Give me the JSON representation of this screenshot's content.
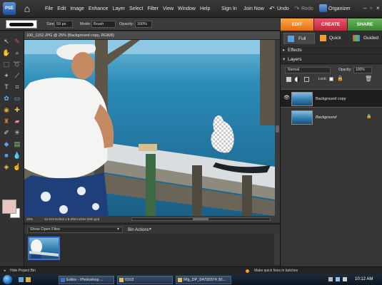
{
  "menubar": {
    "logo": "PSE",
    "items": [
      "File",
      "Edit",
      "Image",
      "Enhance",
      "Layer",
      "Select",
      "Filter",
      "View",
      "Window",
      "Help"
    ],
    "sign_in": "Sign In",
    "join_now": "Join Now",
    "undo": "Undo",
    "redo": "Redo",
    "organizer": "Organizer"
  },
  "options_bar": {
    "size_label": "Size:",
    "size_value": "59 px",
    "mode_label": "Mode:",
    "mode_value": "Brush",
    "opacity_label": "Opacity:",
    "opacity_value": "100%"
  },
  "mode_tabs": {
    "edit": "EDIT",
    "create": "CREATE",
    "share": "SHARE",
    "colors": {
      "edit": "#ef7d1a",
      "create": "#d9334a",
      "share": "#4b9a3c"
    }
  },
  "document": {
    "title": "100_1152.JPG @ 25% (Background copy, RGB/8)",
    "zoom": "25%",
    "dimensions": "12.213 inches x 8.208 inches (250 ppi)"
  },
  "panel": {
    "tabs": [
      "Full",
      "Quick",
      "Guided"
    ],
    "effects_title": "Effects",
    "layers_title": "Layers",
    "blend_mode": "Normal",
    "opacity_label": "Opacity:",
    "opacity_value": "100%",
    "lock_label": "Lock:",
    "layers": [
      {
        "name": "Background copy",
        "selected": true
      },
      {
        "name": "Background",
        "selected": false
      }
    ]
  },
  "project_bin": {
    "show": "Show Open Files",
    "bin_actions": "Bin Actions"
  },
  "bottom": {
    "hide_bin": "Hide Project Bin",
    "tip": "Make quick fixes in batches"
  },
  "taskbar": {
    "items": [
      "Editor - Photoshop ...",
      "0163",
      "Rfg_DP_04700374 30..."
    ],
    "time": "10:12 AM"
  }
}
